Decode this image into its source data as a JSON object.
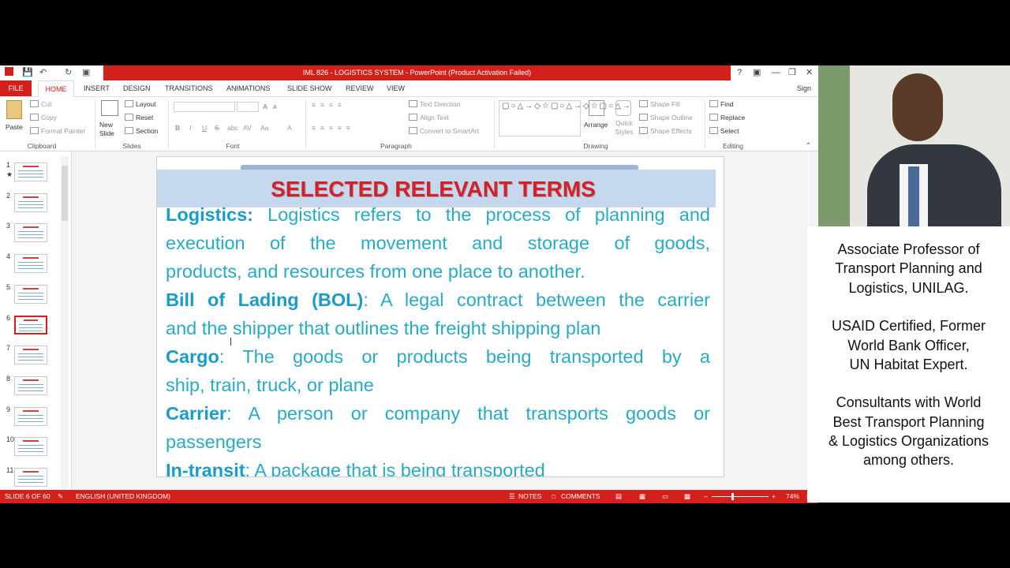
{
  "window": {
    "title": "IML 826 - LOGISTICS SYSTEM - PowerPoint (Product Activation Failed)",
    "help": "?",
    "sign_in": "Sign in"
  },
  "ribbon_tabs": [
    "FILE",
    "HOME",
    "INSERT",
    "DESIGN",
    "TRANSITIONS",
    "ANIMATIONS",
    "SLIDE SHOW",
    "REVIEW",
    "VIEW"
  ],
  "ribbon": {
    "clipboard": {
      "paste": "Paste",
      "cut": "Cut",
      "copy": "Copy",
      "format_painter": "Format Painter",
      "label": "Clipboard"
    },
    "slides": {
      "new_slide": "New Slide",
      "layout": "Layout",
      "reset": "Reset",
      "section": "Section",
      "label": "Slides"
    },
    "font": {
      "label": "Font",
      "bold": "B",
      "italic": "I",
      "underline": "U",
      "strike": "S",
      "shadow": "abc",
      "grow": "A",
      "shrink": "A",
      "color": "A",
      "spacing": "AV",
      "case": "Aa"
    },
    "paragraph": {
      "text_direction": "Text Direction",
      "align_text": "Align Text",
      "smartart": "Convert to SmartArt",
      "label": "Paragraph"
    },
    "drawing": {
      "arrange": "Arrange",
      "quick_styles": "Quick Styles",
      "shape_fill": "Shape Fill",
      "shape_outline": "Shape Outline",
      "shape_effects": "Shape Effects",
      "label": "Drawing"
    },
    "editing": {
      "find": "Find",
      "replace": "Replace",
      "select": "Select",
      "label": "Editing"
    }
  },
  "thumbnails": [
    "1",
    "2",
    "3",
    "4",
    "5",
    "6",
    "7",
    "8",
    "9",
    "10",
    "11"
  ],
  "selected_thumbnail": 6,
  "slide": {
    "title": "SELECTED RELEVANT TERMS",
    "terms": [
      {
        "term": "Logistics:",
        "lines": [
          " Logistics refers to the process of planning and",
          "execution of the movement and storage of goods,",
          "products, and resources from one place to another."
        ]
      },
      {
        "term": "Bill of Lading (BOL)",
        "lines": [
          ": A legal contract between the carrier",
          "and the shipper that outlines the freight shipping plan"
        ]
      },
      {
        "term": "Cargo",
        "lines": [
          ": The goods or products being transported by a",
          "ship, train, truck, or plane"
        ]
      },
      {
        "term": "Carrier",
        "lines": [
          ": A person or company that transports goods or",
          "passengers"
        ]
      },
      {
        "term": "In-transit",
        "lines": [
          ": A package that is being transported"
        ]
      }
    ]
  },
  "status": {
    "slide_info": "SLIDE 6 OF 60",
    "language": "ENGLISH (UNITED KINGDOM)",
    "notes": "NOTES",
    "comments": "COMMENTS",
    "zoom": "74%",
    "zoom_fraction": 0.74
  },
  "presenter": {
    "lines": [
      "Associate Professor of",
      "Transport Planning and",
      "Logistics, UNILAG.",
      "",
      "USAID Certified, Former",
      "World Bank Officer,",
      "UN Habitat Expert.",
      "",
      "Consultants with World",
      "Best Transport Planning",
      "& Logistics Organizations",
      "among others."
    ]
  },
  "colors": {
    "accent": "#d3201b",
    "term": "#1a9cc8",
    "body": "#29aac4",
    "title": "#d4202a"
  }
}
